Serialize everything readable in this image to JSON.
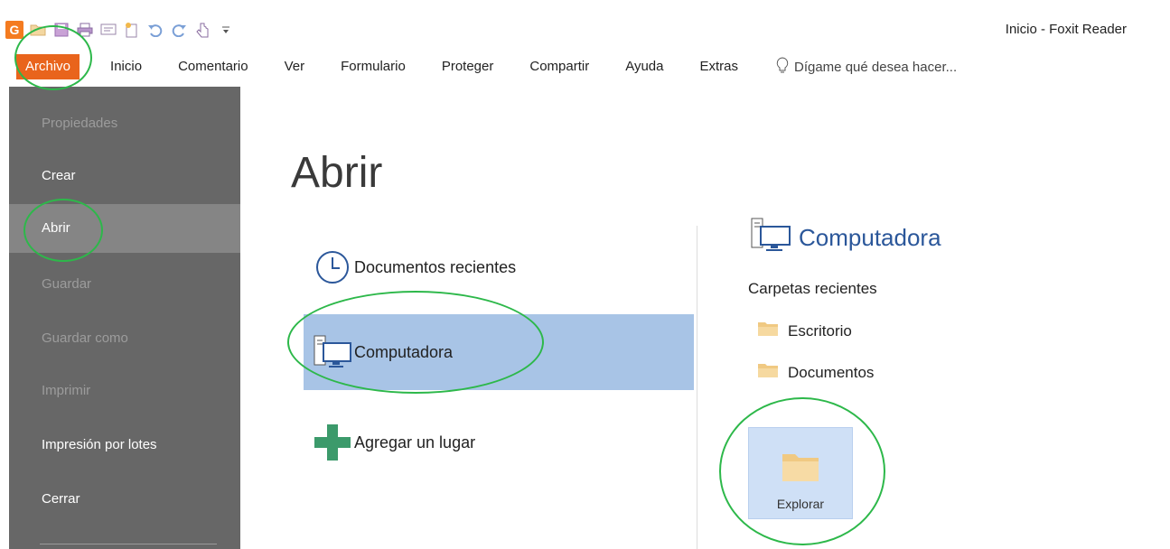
{
  "window": {
    "title": "Inicio - Foxit Reader"
  },
  "quick_access": {
    "icons": [
      "foxit-logo-icon",
      "open-folder-icon",
      "save-icon",
      "print-icon",
      "screen-icon",
      "new-icon",
      "undo-icon",
      "redo-icon",
      "hand-icon",
      "customize-icon"
    ]
  },
  "ribbon": {
    "tabs": [
      "Archivo",
      "Inicio",
      "Comentario",
      "Ver",
      "Formulario",
      "Proteger",
      "Compartir",
      "Ayuda",
      "Extras"
    ],
    "tell_me": "Dígame qué desea hacer..."
  },
  "backstage": {
    "items": [
      {
        "label": "Propiedades",
        "state": "disabled"
      },
      {
        "label": "Crear",
        "state": "enabled"
      },
      {
        "label": "Abrir",
        "state": "selected"
      },
      {
        "label": "Guardar",
        "state": "disabled"
      },
      {
        "label": "Guardar como",
        "state": "disabled"
      },
      {
        "label": "Imprimir",
        "state": "disabled"
      },
      {
        "label": "Impresión por lotes",
        "state": "enabled"
      },
      {
        "label": "Cerrar",
        "state": "enabled"
      }
    ]
  },
  "main": {
    "title": "Abrir",
    "places": {
      "recent": "Documentos recientes",
      "computer": "Computadora",
      "add": "Agregar un lugar"
    },
    "right": {
      "title": "Computadora",
      "recent_folders_label": "Carpetas recientes",
      "folders": [
        "Escritorio",
        "Documentos"
      ],
      "browse": "Explorar"
    }
  },
  "colors": {
    "file_tab": "#e9641c",
    "nav_bg": "#676767",
    "nav_selected": "#858585",
    "place_selected": "#a8c4e6",
    "browse_bg": "#cfe0f6",
    "accent_title": "#2b579a",
    "annotation": "#2db84a"
  }
}
